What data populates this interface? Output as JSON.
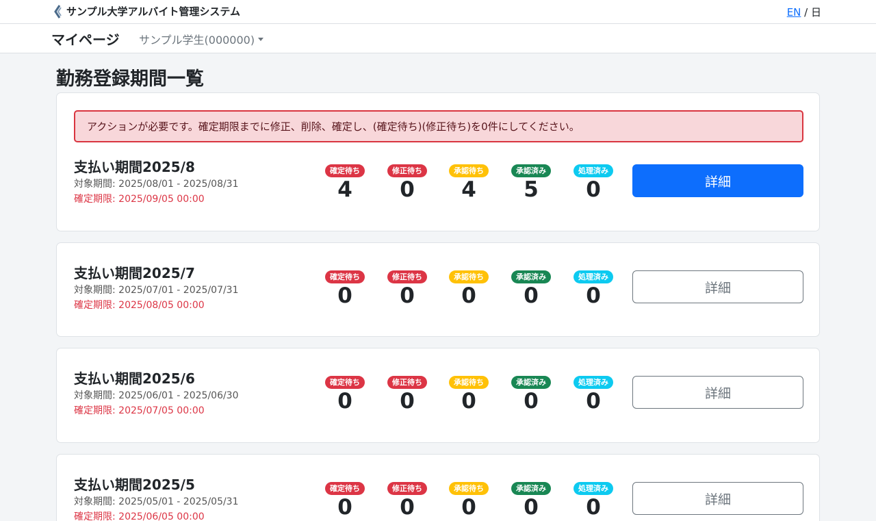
{
  "header": {
    "brand": "サンプル大学アルバイト管理システム",
    "lang_en": "EN",
    "lang_sep": " / ",
    "lang_ja": "日"
  },
  "nav": {
    "title": "マイページ",
    "user": "サンプル学生(000000)"
  },
  "page": {
    "title": "勤務登録期間一覧"
  },
  "alert": "アクションが必要です。確定期限までに修正、削除、確定し、(確定待ち)(修正待ち)を0件にしてください。",
  "status_labels": [
    "確定待ち",
    "修正待ち",
    "承認待ち",
    "承認済み",
    "処理済み"
  ],
  "periods": [
    {
      "name": "支払い期間2025/8",
      "range": "対象期間: 2025/08/01 - 2025/08/31",
      "deadline": "確定期限: 2025/09/05 00:00",
      "counts": [
        "4",
        "0",
        "4",
        "5",
        "0"
      ],
      "button": "詳細"
    },
    {
      "name": "支払い期間2025/7",
      "range": "対象期間: 2025/07/01 - 2025/07/31",
      "deadline": "確定期限: 2025/08/05 00:00",
      "counts": [
        "0",
        "0",
        "0",
        "0",
        "0"
      ],
      "button": "詳細"
    },
    {
      "name": "支払い期間2025/6",
      "range": "対象期間: 2025/06/01 - 2025/06/30",
      "deadline": "確定期限: 2025/07/05 00:00",
      "counts": [
        "0",
        "0",
        "0",
        "0",
        "0"
      ],
      "button": "詳細"
    },
    {
      "name": "支払い期間2025/5",
      "range": "対象期間: 2025/05/01 - 2025/05/31",
      "deadline": "確定期限: 2025/06/05 00:00",
      "counts": [
        "0",
        "0",
        "0",
        "0",
        "0"
      ],
      "button": "詳細"
    }
  ],
  "colors": {
    "primary": "#0d6efd",
    "danger": "#dc3545",
    "warning": "#ffc107",
    "success": "#198754",
    "info": "#0dcaf0"
  }
}
